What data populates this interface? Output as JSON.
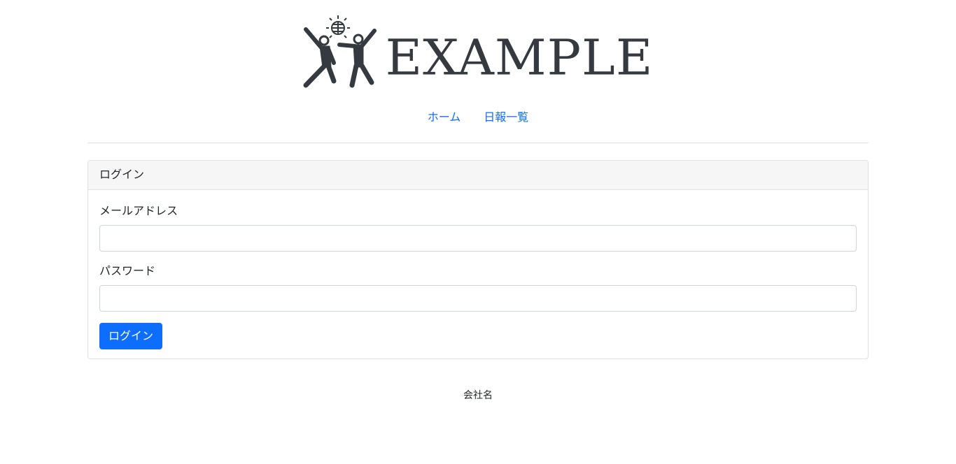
{
  "logo": {
    "text": "EXAMPLE",
    "icon": "dancing-people-disco-ball-icon",
    "color": "#343a40"
  },
  "nav": {
    "items": [
      {
        "label": "ホーム"
      },
      {
        "label": "日報一覧"
      }
    ],
    "link_color": "#0d6efd"
  },
  "login_card": {
    "header": "ログイン",
    "email": {
      "label": "メールアドレス",
      "value": "",
      "placeholder": ""
    },
    "password": {
      "label": "パスワード",
      "value": "",
      "placeholder": ""
    },
    "submit_label": "ログイン",
    "button_color": "#0d6efd"
  },
  "footer": {
    "text": "会社名"
  }
}
